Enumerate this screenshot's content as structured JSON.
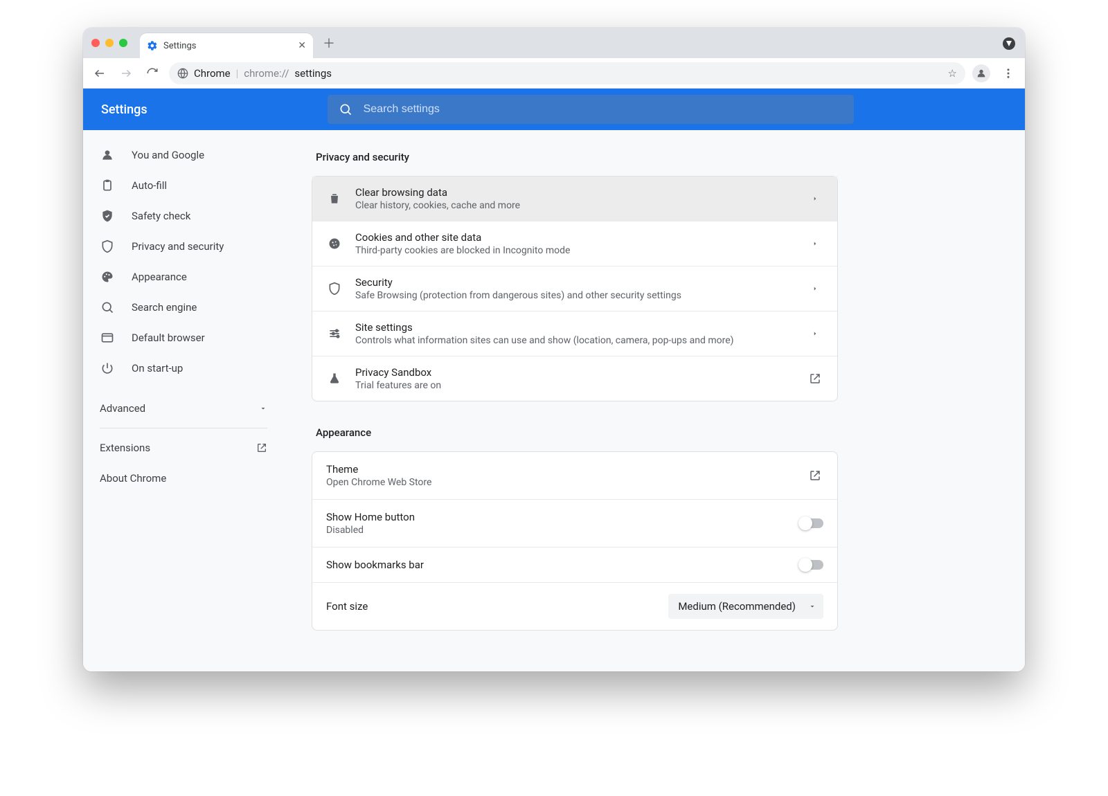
{
  "browser": {
    "tab_title": "Settings",
    "omnibox": {
      "brand": "Chrome",
      "scheme": "chrome://",
      "path": "settings"
    }
  },
  "header": {
    "app_title": "Settings",
    "search_placeholder": "Search settings"
  },
  "sidebar": {
    "items": [
      {
        "icon": "person-icon",
        "label": "You and Google"
      },
      {
        "icon": "clipboard-icon",
        "label": "Auto-fill"
      },
      {
        "icon": "shield-check-icon",
        "label": "Safety check"
      },
      {
        "icon": "shield-icon",
        "label": "Privacy and security"
      },
      {
        "icon": "palette-icon",
        "label": "Appearance"
      },
      {
        "icon": "search-icon",
        "label": "Search engine"
      },
      {
        "icon": "window-icon",
        "label": "Default browser"
      },
      {
        "icon": "power-icon",
        "label": "On start-up"
      }
    ],
    "advanced": "Advanced",
    "extensions": "Extensions",
    "about": "About Chrome"
  },
  "sections": {
    "privacy": {
      "title": "Privacy and security",
      "rows": [
        {
          "icon": "trash-icon",
          "title": "Clear browsing data",
          "sub": "Clear history, cookies, cache and more",
          "trail": "chevron"
        },
        {
          "icon": "cookie-icon",
          "title": "Cookies and other site data",
          "sub": "Third-party cookies are blocked in Incognito mode",
          "trail": "chevron"
        },
        {
          "icon": "shield-icon",
          "title": "Security",
          "sub": "Safe Browsing (protection from dangerous sites) and other security settings",
          "trail": "chevron"
        },
        {
          "icon": "tune-icon",
          "title": "Site settings",
          "sub": "Controls what information sites can use and show (location, camera, pop-ups and more)",
          "trail": "chevron"
        },
        {
          "icon": "flask-icon",
          "title": "Privacy Sandbox",
          "sub": "Trial features are on",
          "trail": "open"
        }
      ]
    },
    "appearance": {
      "title": "Appearance",
      "rows": [
        {
          "title": "Theme",
          "sub": "Open Chrome Web Store",
          "trail": "open"
        },
        {
          "title": "Show Home button",
          "sub": "Disabled",
          "trail": "toggle"
        },
        {
          "title": "Show bookmarks bar",
          "trail": "toggle"
        },
        {
          "title": "Font size",
          "trail": "dropdown",
          "value": "Medium (Recommended)"
        }
      ]
    }
  }
}
